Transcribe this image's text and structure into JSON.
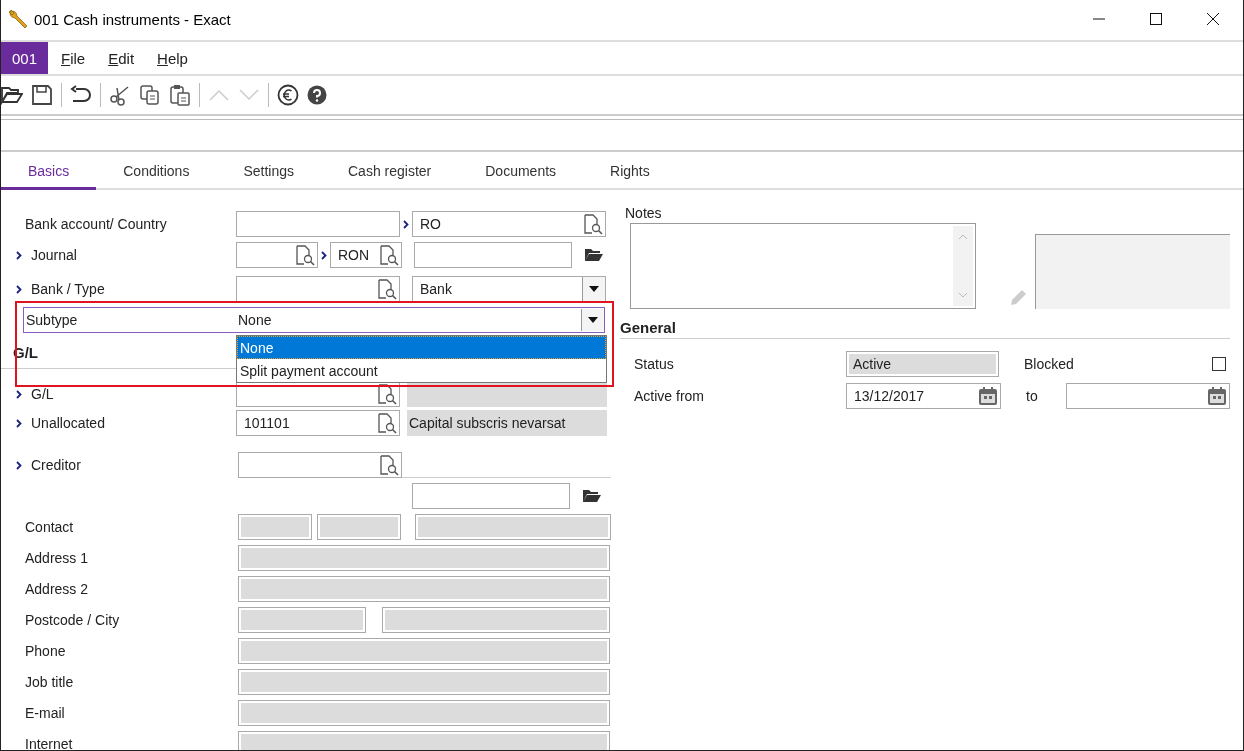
{
  "window": {
    "title": "001 Cash instruments - Exact"
  },
  "company_badge": "001",
  "menu": [
    {
      "label": "File"
    },
    {
      "label": "Edit"
    },
    {
      "label": "Help"
    }
  ],
  "tabs": [
    {
      "label": "Basics",
      "selected": true
    },
    {
      "label": "Conditions",
      "selected": false
    },
    {
      "label": "Settings",
      "selected": false
    },
    {
      "label": "Cash register",
      "selected": false
    },
    {
      "label": "Documents",
      "selected": false
    },
    {
      "label": "Rights",
      "selected": false
    }
  ],
  "bank_account": {
    "label": "Bank account/ Country",
    "link": false,
    "country": "RO"
  },
  "journal": {
    "label": "Journal",
    "link": true,
    "currency": "RON"
  },
  "bank_type": {
    "label": "Bank / Type",
    "link": true,
    "type": "Bank"
  },
  "subtype": {
    "label": "Subtype",
    "value": "None",
    "expanded": true,
    "highlighted": true,
    "options": [
      {
        "label": "None",
        "selected": true
      },
      {
        "label": "Split payment account",
        "selected": false
      }
    ]
  },
  "gl_section": {
    "title": "G/L",
    "gl": {
      "label": "G/L",
      "link": true
    },
    "unallocated": {
      "label": "Unallocated",
      "link": true,
      "code": "101101",
      "description": "Capital subscris nevarsat"
    }
  },
  "creditor": {
    "label": "Creditor",
    "link": true
  },
  "contact_rows": [
    {
      "label": "Contact",
      "kind": "triple"
    },
    {
      "label": "Address 1",
      "kind": "full"
    },
    {
      "label": "Address 2",
      "kind": "full"
    },
    {
      "label": "Postcode / City",
      "kind": "split"
    },
    {
      "label": "Phone",
      "kind": "full"
    },
    {
      "label": "Job title",
      "kind": "full"
    },
    {
      "label": "E-mail",
      "kind": "full"
    },
    {
      "label": "Internet",
      "kind": "full"
    }
  ],
  "notes": {
    "label": "Notes"
  },
  "general": {
    "title": "General",
    "status_label": "Status",
    "status": "Active",
    "blocked_label": "Blocked",
    "blocked": false,
    "active_from_label": "Active from",
    "active_from": "13/12/2017",
    "to_label": "to"
  }
}
